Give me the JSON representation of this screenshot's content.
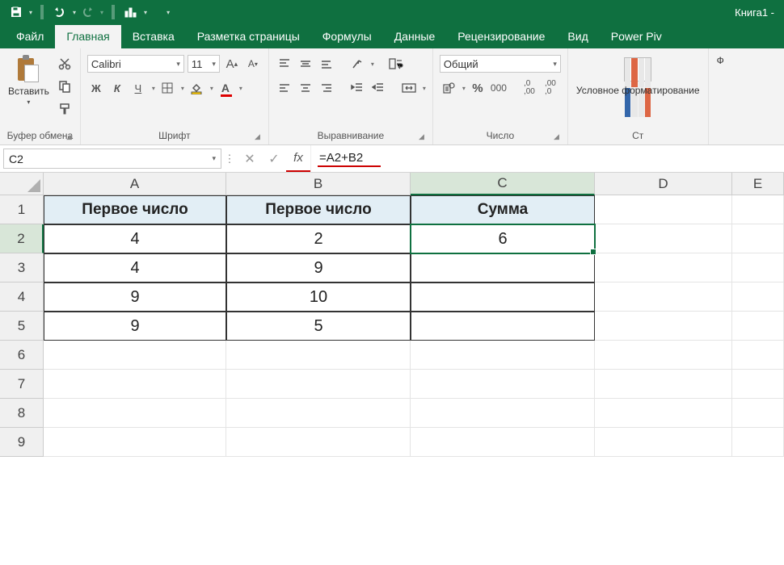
{
  "app": {
    "title": "Книга1 -"
  },
  "tabs": {
    "items": [
      "Файл",
      "Главная",
      "Вставка",
      "Разметка страницы",
      "Формулы",
      "Данные",
      "Рецензирование",
      "Вид",
      "Power Piv"
    ],
    "active": "Главная"
  },
  "ribbon": {
    "clipboard": {
      "paste": "Вставить",
      "label": "Буфер обмена"
    },
    "font": {
      "name": "Calibri",
      "size": "11",
      "label": "Шрифт",
      "bold": "Ж",
      "italic": "К",
      "underline": "Ч"
    },
    "align": {
      "label": "Выравнивание"
    },
    "number": {
      "format": "Общий",
      "label": "Число"
    },
    "styles": {
      "cond": "Условное форматирование",
      "label": "Ст"
    },
    "right": {
      "f": "Ф"
    }
  },
  "formula_bar": {
    "name_box": "C2",
    "formula": "=A2+B2",
    "fx": "fx"
  },
  "sheet": {
    "columns": [
      "A",
      "B",
      "C",
      "D",
      "E"
    ],
    "selected_col": "C",
    "selected_row": "2",
    "rows": [
      "1",
      "2",
      "3",
      "4",
      "5",
      "6",
      "7",
      "8",
      "9"
    ],
    "headers": [
      "Первое число",
      "Первое число",
      "Сумма"
    ],
    "data": [
      {
        "a": "4",
        "b": "2",
        "c": "6"
      },
      {
        "a": "4",
        "b": "9",
        "c": ""
      },
      {
        "a": "9",
        "b": "10",
        "c": ""
      },
      {
        "a": "9",
        "b": "5",
        "c": ""
      }
    ]
  }
}
